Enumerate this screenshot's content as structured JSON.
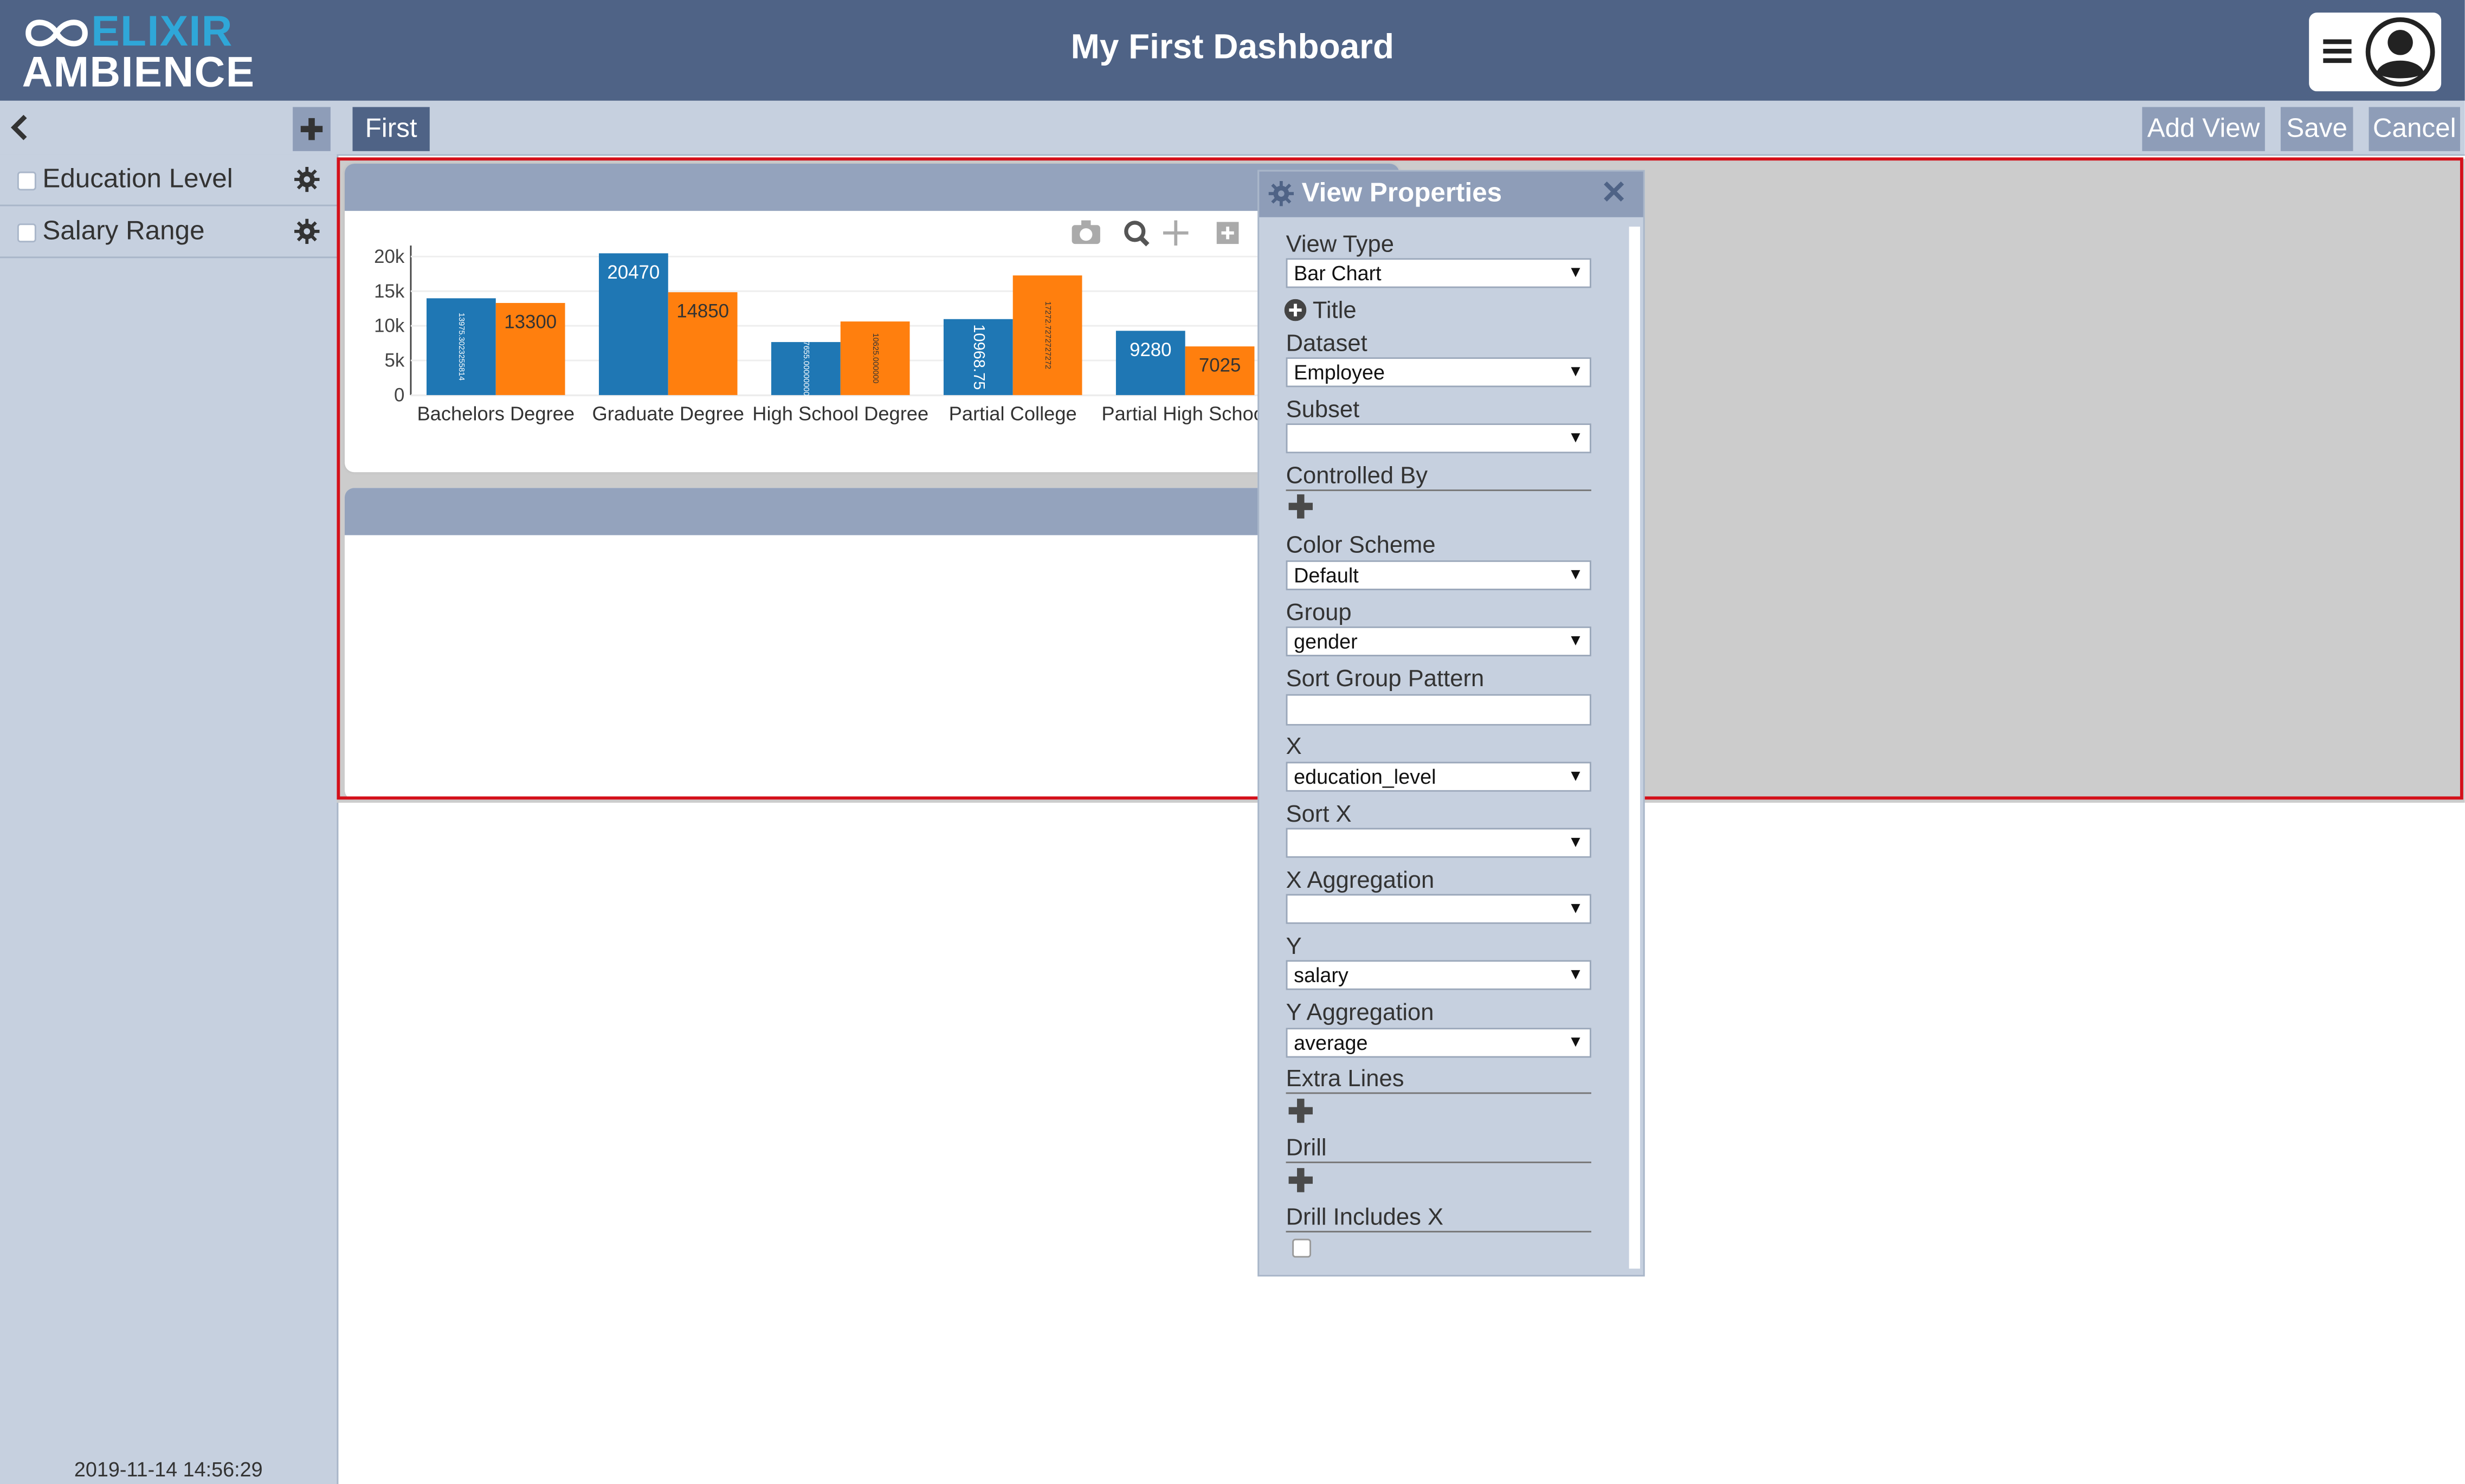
{
  "header": {
    "logo_top": "ELIXIR",
    "logo_bottom": "AMBIENCE",
    "title": "My First Dashboard"
  },
  "toolbar": {
    "tab_label": "First",
    "add_view": "Add View",
    "save": "Save",
    "cancel": "Cancel"
  },
  "sidebar": {
    "items": [
      {
        "label": "Education Level"
      },
      {
        "label": "Salary Range"
      }
    ],
    "timestamp": "2019-11-14 14:56:29"
  },
  "view_properties": {
    "title": "View Properties",
    "view_type_label": "View Type",
    "view_type_value": "Bar Chart",
    "title_label": "Title",
    "dataset_label": "Dataset",
    "dataset_value": "Employee",
    "subset_label": "Subset",
    "subset_value": "",
    "controlled_by_label": "Controlled By",
    "color_scheme_label": "Color Scheme",
    "color_scheme_value": "Default",
    "group_label": "Group",
    "group_value": "gender",
    "sort_group_label": "Sort Group Pattern",
    "sort_group_value": "",
    "x_label": "X",
    "x_value": "education_level",
    "sort_x_label": "Sort X",
    "sort_x_value": "",
    "x_agg_label": "X Aggregation",
    "x_agg_value": "",
    "y_label": "Y",
    "y_value": "salary",
    "y_agg_label": "Y Aggregation",
    "y_agg_value": "average",
    "extra_lines_label": "Extra Lines",
    "drill_label": "Drill",
    "drill_includes_label": "Drill Includes X"
  },
  "chart_data": {
    "type": "bar",
    "categories": [
      "Bachelors Degree",
      "Graduate Degree",
      "High School Degree",
      "Partial College",
      "Partial High School"
    ],
    "series": [
      {
        "values": [
          13975.3,
          20470,
          7655,
          10968.75,
          9280
        ],
        "labels": [
          "13975.3023255814",
          "20470",
          "7655.00000000",
          "10968.75",
          "9280"
        ],
        "color": "#1f77b4"
      },
      {
        "values": [
          13300,
          14850,
          10625,
          17272.7,
          7025
        ],
        "labels": [
          "13300",
          "14850",
          "10625.000000",
          "17272.7272727272",
          "7025"
        ],
        "color": "#ff7f0e"
      }
    ],
    "yticks": [
      "0",
      "5k",
      "10k",
      "15k",
      "20k"
    ],
    "ylim": [
      0,
      20000
    ]
  },
  "colors": {
    "header": "#4f6386",
    "panel": "#c6d0df",
    "accent": "#2fa7d8",
    "highlight": "#d4101a"
  }
}
